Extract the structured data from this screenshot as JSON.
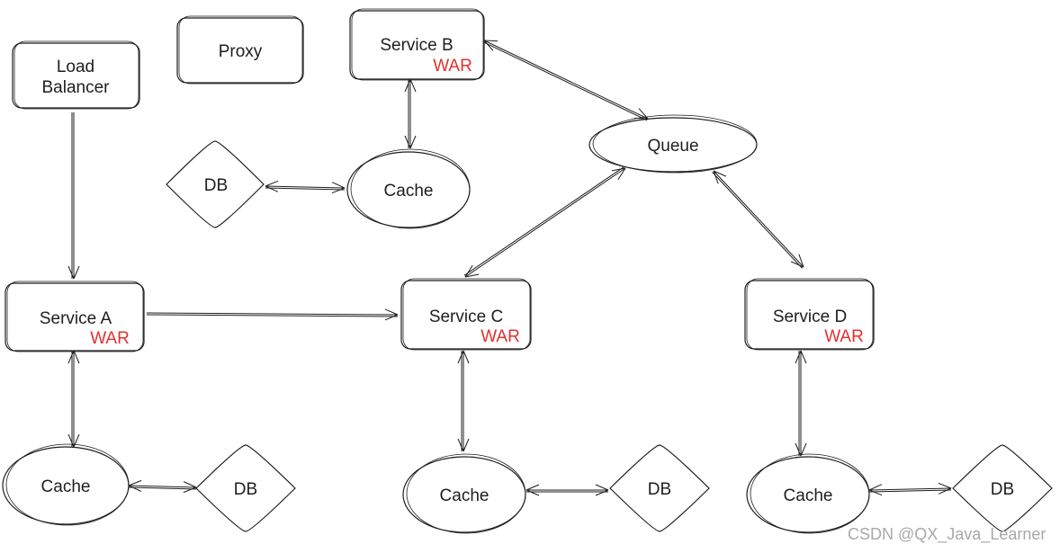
{
  "nodes": {
    "load_balancer": {
      "line1": "Load",
      "line2": "Balancer"
    },
    "proxy": {
      "label": "Proxy"
    },
    "service_b": {
      "label": "Service B",
      "tag": "WAR"
    },
    "queue": {
      "label": "Queue"
    },
    "db_b": {
      "label": "DB"
    },
    "cache_b": {
      "label": "Cache"
    },
    "service_a": {
      "label": "Service A",
      "tag": "WAR"
    },
    "service_c": {
      "label": "Service C",
      "tag": "WAR"
    },
    "service_d": {
      "label": "Service D",
      "tag": "WAR"
    },
    "cache_a": {
      "label": "Cache"
    },
    "db_a": {
      "label": "DB"
    },
    "cache_c": {
      "label": "Cache"
    },
    "db_c": {
      "label": "DB"
    },
    "cache_d": {
      "label": "Cache"
    },
    "db_d": {
      "label": "DB"
    }
  },
  "edges": [
    {
      "from": "load_balancer",
      "to": "service_a",
      "direction": "forward"
    },
    {
      "from": "service_a",
      "to": "service_c",
      "direction": "forward"
    },
    {
      "from": "service_b",
      "to": "cache_b",
      "direction": "both"
    },
    {
      "from": "db_b",
      "to": "cache_b",
      "direction": "both"
    },
    {
      "from": "service_b",
      "to": "queue",
      "direction": "both"
    },
    {
      "from": "queue",
      "to": "service_c",
      "direction": "both"
    },
    {
      "from": "queue",
      "to": "service_d",
      "direction": "both"
    },
    {
      "from": "service_a",
      "to": "cache_a",
      "direction": "both"
    },
    {
      "from": "cache_a",
      "to": "db_a",
      "direction": "both"
    },
    {
      "from": "service_c",
      "to": "cache_c",
      "direction": "both"
    },
    {
      "from": "cache_c",
      "to": "db_c",
      "direction": "both"
    },
    {
      "from": "service_d",
      "to": "cache_d",
      "direction": "both"
    },
    {
      "from": "cache_d",
      "to": "db_d",
      "direction": "both"
    }
  ],
  "colors": {
    "stroke": "#1e1e1e",
    "tag": "#e03131",
    "watermark": "#a8a8a8"
  },
  "watermark": "CSDN @QX_Java_Learner"
}
